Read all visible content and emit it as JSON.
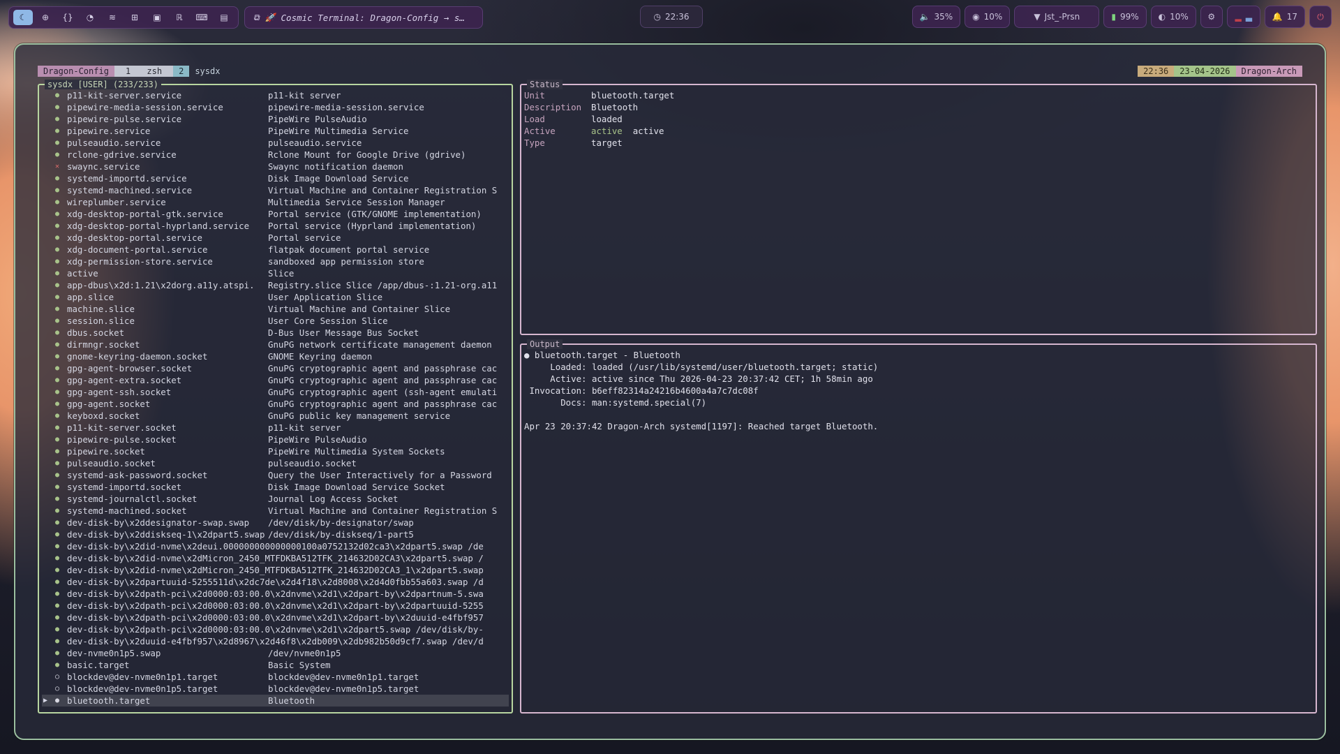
{
  "topbar": {
    "workspaces": [
      {
        "icon": "☾",
        "name": "moon-icon",
        "active": true
      },
      {
        "icon": "⊕",
        "name": "globe-icon"
      },
      {
        "icon": "{}",
        "name": "code-icon"
      },
      {
        "icon": "◔",
        "name": "spotify-icon"
      },
      {
        "icon": "≋",
        "name": "layers-icon"
      },
      {
        "icon": "⊞",
        "name": "grid-icon"
      },
      {
        "icon": "▣",
        "name": "note-icon"
      },
      {
        "icon": "ℝ",
        "name": "r-icon"
      },
      {
        "icon": "⌨",
        "name": "terminal-icon"
      },
      {
        "icon": "▤",
        "name": "doc-icon"
      }
    ],
    "window_title": "Cosmic Terminal: Dragon-Config → s…",
    "clock": "22:36",
    "volume": "35%",
    "mic": "10%",
    "network": "Jst_-Prsn",
    "battery": "99%",
    "brightness": "10%",
    "notifications": "17"
  },
  "tmux": {
    "session": "Dragon-Config",
    "win1_index": "1",
    "win1_name": "zsh",
    "win2_index": "2",
    "win2_name": "sysdx",
    "time": "22:36",
    "date": "23-04-2026",
    "host": "Dragon-Arch"
  },
  "left": {
    "title": "sysdx [USER] (233/233)",
    "rows": [
      [
        "o",
        "p11-kit-server.service",
        "p11-kit server"
      ],
      [
        "o",
        "pipewire-media-session.service",
        "pipewire-media-session.service"
      ],
      [
        "o",
        "pipewire-pulse.service",
        "PipeWire PulseAudio"
      ],
      [
        "o",
        "pipewire.service",
        "PipeWire Multimedia Service"
      ],
      [
        "o",
        "pulseaudio.service",
        "pulseaudio.service"
      ],
      [
        "o",
        "rclone-gdrive.service",
        "Rclone Mount for Google Drive (gdrive)"
      ],
      [
        "x",
        "swaync.service",
        "Swaync notification daemon"
      ],
      [
        "o",
        "systemd-importd.service",
        "Disk Image Download Service"
      ],
      [
        "o",
        "systemd-machined.service",
        "Virtual Machine and Container Registration S"
      ],
      [
        "o",
        "wireplumber.service",
        "Multimedia Service Session Manager"
      ],
      [
        "o",
        "xdg-desktop-portal-gtk.service",
        "Portal service (GTK/GNOME implementation)"
      ],
      [
        "o",
        "xdg-desktop-portal-hyprland.service",
        "Portal service (Hyprland implementation)"
      ],
      [
        "o",
        "xdg-desktop-portal.service",
        "Portal service"
      ],
      [
        "o",
        "xdg-document-portal.service",
        "flatpak document portal service"
      ],
      [
        "o",
        "xdg-permission-store.service",
        "sandboxed app permission store"
      ],
      [
        "o",
        "active",
        "Slice"
      ],
      [
        "o",
        "app-dbus\\x2d:1.21\\x2dorg.a11y.atspi.",
        "Registry.slice Slice /app/dbus-:1.21-org.a11"
      ],
      [
        "o",
        "app.slice",
        "User Application Slice"
      ],
      [
        "o",
        "machine.slice",
        "Virtual Machine and Container Slice"
      ],
      [
        "o",
        "session.slice",
        "User Core Session Slice"
      ],
      [
        "o",
        "dbus.socket",
        "D-Bus User Message Bus Socket"
      ],
      [
        "o",
        "dirmngr.socket",
        "GnuPG network certificate management daemon"
      ],
      [
        "o",
        "gnome-keyring-daemon.socket",
        "GNOME Keyring daemon"
      ],
      [
        "o",
        "gpg-agent-browser.socket",
        "GnuPG cryptographic agent and passphrase cac"
      ],
      [
        "o",
        "gpg-agent-extra.socket",
        "GnuPG cryptographic agent and passphrase cac"
      ],
      [
        "o",
        "gpg-agent-ssh.socket",
        "GnuPG cryptographic agent (ssh-agent emulati"
      ],
      [
        "o",
        "gpg-agent.socket",
        "GnuPG cryptographic agent and passphrase cac"
      ],
      [
        "o",
        "keyboxd.socket",
        "GnuPG public key management service"
      ],
      [
        "o",
        "p11-kit-server.socket",
        "p11-kit server"
      ],
      [
        "o",
        "pipewire-pulse.socket",
        "PipeWire PulseAudio"
      ],
      [
        "o",
        "pipewire.socket",
        "PipeWire Multimedia System Sockets"
      ],
      [
        "o",
        "pulseaudio.socket",
        "pulseaudio.socket"
      ],
      [
        "o",
        "systemd-ask-password.socket",
        "Query the User Interactively for a Password"
      ],
      [
        "o",
        "systemd-importd.socket",
        "Disk Image Download Service Socket"
      ],
      [
        "o",
        "systemd-journalctl.socket",
        "Journal Log Access Socket"
      ],
      [
        "o",
        "systemd-machined.socket",
        "Virtual Machine and Container Registration S"
      ],
      [
        "o",
        "dev-disk-by\\x2ddesignator-swap.swap",
        "/dev/disk/by-designator/swap"
      ],
      [
        "o",
        "dev-disk-by\\x2ddiskseq-1\\x2dpart5.swap",
        "/dev/disk/by-diskseq/1-part5"
      ],
      [
        "o",
        "dev-disk-by\\x2did-nvme\\x2deui.000000000000000100a0752132d02ca3\\x2dpart5.swap /de",
        ""
      ],
      [
        "o",
        "dev-disk-by\\x2did-nvme\\x2dMicron_2450_MTFDKBA512TFK_214632D02CA3\\x2dpart5.swap /",
        ""
      ],
      [
        "o",
        "dev-disk-by\\x2did-nvme\\x2dMicron_2450_MTFDKBA512TFK_214632D02CA3_1\\x2dpart5.swap",
        ""
      ],
      [
        "o",
        "dev-disk-by\\x2dpartuuid-5255511d\\x2dc7de\\x2d4f18\\x2d8008\\x2d4d0fbb55a603.swap /d",
        ""
      ],
      [
        "o",
        "dev-disk-by\\x2dpath-pci\\x2d0000:03:00.0\\x2dnvme\\x2d1\\x2dpart-by\\x2dpartnum-5.swa",
        ""
      ],
      [
        "o",
        "dev-disk-by\\x2dpath-pci\\x2d0000:03:00.0\\x2dnvme\\x2d1\\x2dpart-by\\x2dpartuuid-5255",
        ""
      ],
      [
        "o",
        "dev-disk-by\\x2dpath-pci\\x2d0000:03:00.0\\x2dnvme\\x2d1\\x2dpart-by\\x2duuid-e4fbf957",
        ""
      ],
      [
        "o",
        "dev-disk-by\\x2dpath-pci\\x2d0000:03:00.0\\x2dnvme\\x2d1\\x2dpart5.swap /dev/disk/by-",
        ""
      ],
      [
        "o",
        "dev-disk-by\\x2duuid-e4fbf957\\x2d8967\\x2d46f8\\x2db009\\x2db982b50d9cf7.swap /dev/d",
        ""
      ],
      [
        "o",
        "dev-nvme0n1p5.swap",
        "/dev/nvme0n1p5"
      ],
      [
        "o",
        "basic.target",
        "Basic System"
      ],
      [
        "w",
        "blockdev@dev-nvme0n1p1.target",
        "blockdev@dev-nvme0n1p1.target"
      ],
      [
        "w",
        "blockdev@dev-nvme0n1p5.target",
        "blockdev@dev-nvme0n1p5.target"
      ],
      [
        "s",
        "bluetooth.target",
        "Bluetooth"
      ]
    ]
  },
  "status": {
    "title": "Status",
    "unit_label": "Unit",
    "unit": "bluetooth.target",
    "desc_label": "Description",
    "desc": "Bluetooth",
    "load_label": "Load",
    "load": "loaded",
    "active_label": "Active",
    "active_state": "active",
    "active_sub": "active",
    "type_label": "Type",
    "type": "target"
  },
  "output": {
    "title": "Output",
    "lines": [
      "● bluetooth.target - Bluetooth",
      "     Loaded: loaded (/usr/lib/systemd/user/bluetooth.target; static)",
      "     Active: active since Thu 2026-04-23 20:37:42 CET; 1h 58min ago",
      " Invocation: b6eff82314a24216b4600a4a7c7dc08f",
      "       Docs: man:systemd.special(7)",
      "",
      "Apr 23 20:37:42 Dragon-Arch systemd[1197]: Reached target Bluetooth."
    ]
  },
  "colors": {
    "accent": "#8fb8e6",
    "border_left": "#b8d6a0",
    "border_right": "#d6b6cf",
    "active_dot": "#a8c38a",
    "failed_dot": "#e06c6c"
  }
}
